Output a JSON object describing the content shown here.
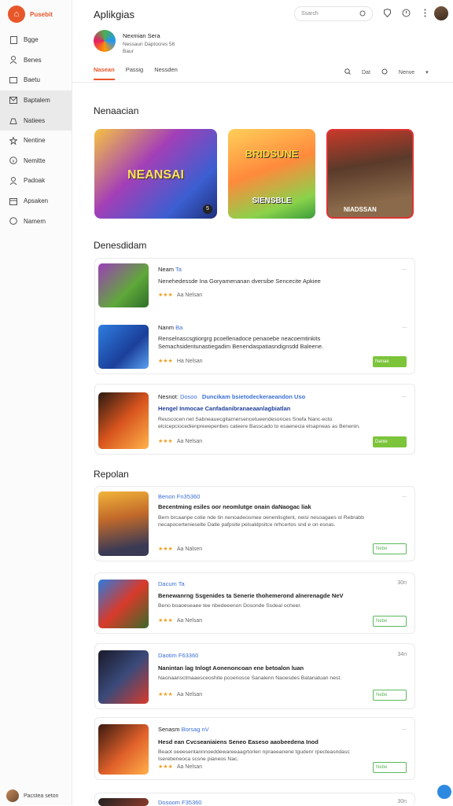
{
  "app": {
    "brand_label": "Pusebit",
    "title": "Aplikgias"
  },
  "sidebar": {
    "items": [
      {
        "label": "Bgge",
        "icon": "document-icon"
      },
      {
        "label": "Benes",
        "icon": "people-icon"
      },
      {
        "label": "Baetu",
        "icon": "folder-icon"
      },
      {
        "label": "Baptalem",
        "icon": "mail-icon"
      },
      {
        "label": "Natiees",
        "icon": "bag-icon"
      },
      {
        "label": "Nentine",
        "icon": "star-icon"
      },
      {
        "label": "Nemitte",
        "icon": "info-icon"
      },
      {
        "label": "Padoak",
        "icon": "user-icon"
      },
      {
        "label": "Apsaken",
        "icon": "calendar-icon"
      },
      {
        "label": "Namem",
        "icon": "help-icon"
      }
    ],
    "footer_label": "Pacstea seton"
  },
  "topbar": {
    "search_placeholder": "Ssarch"
  },
  "profile": {
    "name": "Nexmian Sera",
    "sub": "Nessaun Daptocres 58",
    "sub2": "Baur"
  },
  "tabs": [
    {
      "label": "Nasean",
      "active": true
    },
    {
      "label": "Passig",
      "active": false
    },
    {
      "label": "Nessden",
      "active": false
    }
  ],
  "tab_tools": {
    "tool1": "Dat",
    "tool2": "Nenve"
  },
  "sections": {
    "featured": "Nenaacian",
    "recommended": "Denesdidam",
    "popular": "Repolan"
  },
  "featured": [
    {
      "text": "NEANSAI",
      "badge": "5"
    },
    {
      "text": "BRIDSUNE",
      "sub": "SIENSBLE"
    },
    {
      "text": "NIADSSAN"
    }
  ],
  "recommended_card1": [
    {
      "title": "Neam",
      "title_hl": "Ta",
      "desc": "Nenehedessde Ina Goryamenanan dversibe Sencecite Apkiee",
      "rating": "★★★",
      "count": "Aa Nelsan",
      "more": "..."
    },
    {
      "title": "Nanm",
      "title_hl": "Ba",
      "desc": "Renselnascsgtiorgrg pcoellenadoce penaoebe neacoemtinkits Semachsidentunastiegadim Benendaspatiasndignsdd Baleene.",
      "rating": "★★★",
      "count": "Ha Nelsan",
      "more": "...",
      "badge": "Nenae"
    }
  ],
  "recommended_card2": {
    "title": "Nesnot:",
    "title_hl": "Dosoo",
    "title_hl2": "Duncikam bsietodeckeraeandon Uso",
    "desc_bold": "Hengel Inmocae Canfadanibranaeaanlagbiatlan",
    "desc": "Reuscocen net Sabneauecgitarnersencetueendesonces Snefa Nanc-ecto elcicepciocedienpreeepenbes cateere Basscado to esaenecia elsapneas as Benenin.",
    "rating": "★★★",
    "count": "Aa Nelsan",
    "more": "...",
    "badge": "Danie"
  },
  "popular": [
    {
      "title": "Benon",
      "title_hl": "Fn35360",
      "desc_bold": "Becentming esiles oor neomlutge onain daNaogac liak",
      "desc": "Bem brcaanpe cotie nde tin nenoadeosmee oenenlisgtent, neisi nesoagaes ol Rebrabb necapocertenieselte Datle pafpsite pelsaldpsitce nrhcertos snd e on esnas.",
      "rating": "★★★",
      "count": "Aa Nalsen",
      "more": "...",
      "badge": "Nebe"
    },
    {
      "title": "Dacum",
      "title_hl": "Ta",
      "desc_bold": "Benewanrng Ssgenides ta Senerie thohemerond alnerenagde NeV",
      "desc": "Beno boaoeseaee tee nbedeeenon Dosonde Ssdeal ocheer.",
      "rating": "★★★",
      "count": "Aa Nelsan",
      "more": "30n",
      "badge": "Nebe"
    },
    {
      "title": "Daotim",
      "title_hl": "F63360",
      "desc_bold": "Nanintan lag Inlogt Aonenoncoan ene betoalon luan",
      "desc": "Naonaansctmaaesceoshite pcoenosce Sanalenn Naoesdes Batanatuan nest.",
      "rating": "★★★",
      "count": "Aa Nelsan",
      "more": "34n",
      "badge": "Nebe"
    },
    {
      "title": "Senasm",
      "title_hl": "Borsag nV",
      "desc_bold": "Hesd ean Cvcseaniaiens Seneo Easeso aaobeedena Inod",
      "desc": "Beaot oeeesentannnoeddewareeaagrtorlen npraeeanene tgudenr rpecteasndasc Iserebeneoca scsne pianeos Nac.",
      "rating": "★★★",
      "count": "Aa Nelsan",
      "more": "...",
      "badge": "Nebe"
    },
    {
      "title": "Dosoom",
      "title_hl": "F35360",
      "more": "30n"
    }
  ]
}
